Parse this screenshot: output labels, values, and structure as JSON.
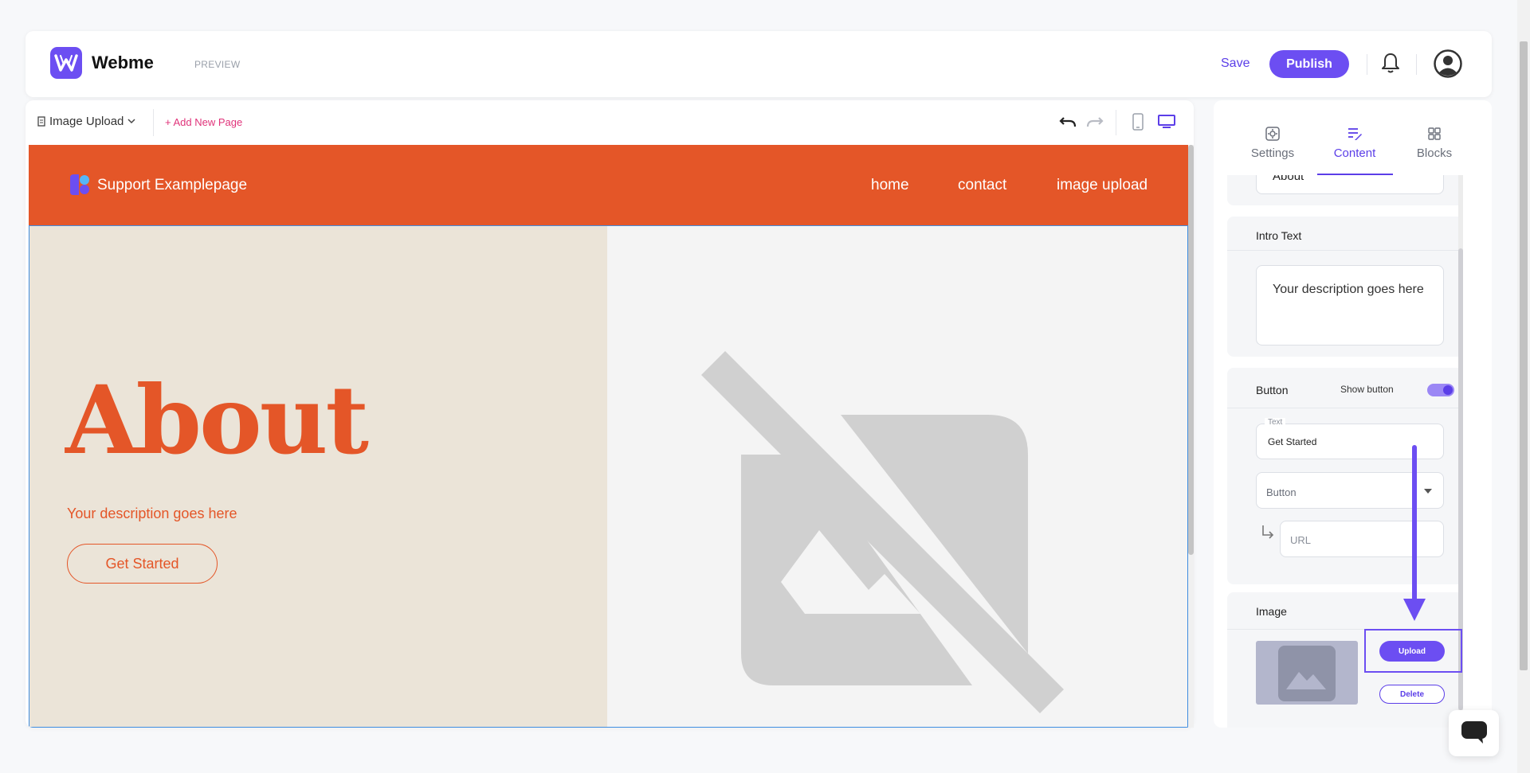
{
  "header": {
    "brand": "Webme",
    "preview_label": "PREVIEW",
    "save_label": "Save",
    "publish_label": "Publish",
    "icons": [
      "bell-icon",
      "user-avatar-icon"
    ]
  },
  "toolbar": {
    "page_selector": "Image Upload",
    "add_page": "+ Add New Page",
    "icons": [
      "undo-icon",
      "redo-icon",
      "mobile-view-icon",
      "desktop-view-icon"
    ]
  },
  "site": {
    "name": "Support Examplepage",
    "nav": [
      "home",
      "contact",
      "image upload"
    ],
    "hero_title": "About",
    "hero_desc": "Your description goes here",
    "hero_button": "Get Started",
    "accent": "#e45628"
  },
  "panel": {
    "tabs": [
      {
        "label": "Settings",
        "icon": "gear-icon"
      },
      {
        "label": "Content",
        "icon": "edit-icon"
      },
      {
        "label": "Blocks",
        "icon": "blocks-icon"
      }
    ],
    "active_tab": "Content",
    "title_field_value": "About",
    "intro_title": "Intro Text",
    "intro_value": "Your description goes here",
    "button_title": "Button",
    "show_button_label": "Show button",
    "show_button_on": true,
    "text_legend": "Text",
    "text_value": "Get Started",
    "button_type_placeholder": "Button",
    "url_placeholder": "URL",
    "image_title": "Image",
    "upload_label": "Upload",
    "delete_label": "Delete",
    "accent": "#6c4ef2"
  }
}
